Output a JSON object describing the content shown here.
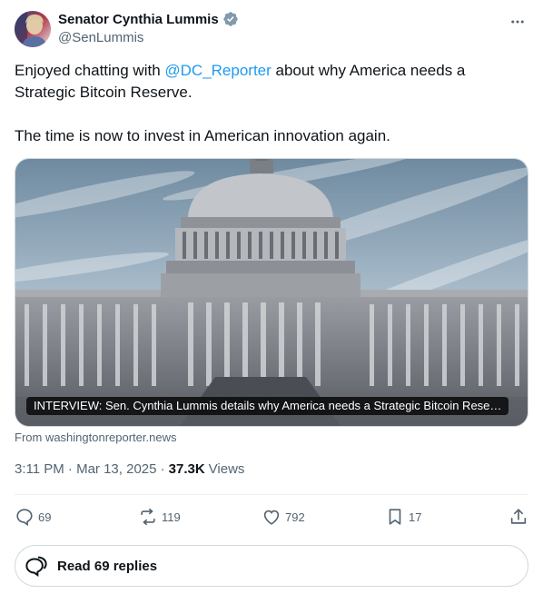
{
  "author": {
    "display_name": "Senator Cynthia Lummis",
    "handle": "@SenLummis"
  },
  "tweet": {
    "text_before_mention": "Enjoyed chatting with ",
    "mention": "@DC_Reporter",
    "text_after_mention": " about why America needs a Strategic Bitcoin Reserve.",
    "text_paragraph_2": "The time is now to invest in American innovation again."
  },
  "card": {
    "title": "INTERVIEW: Sen. Cynthia Lummis details why America needs a Strategic Bitcoin Rese…",
    "source": "From washingtonreporter.news"
  },
  "meta": {
    "timestamp": "3:11 PM · Mar 13, 2025 ·",
    "views_count": "37.3K",
    "views_label": "Views"
  },
  "actions": {
    "replies": "69",
    "reposts": "119",
    "likes": "792",
    "bookmarks": "17"
  },
  "replies_button": {
    "label": "Read 69 replies"
  },
  "colors": {
    "accent": "#1d9bf0",
    "verified_badge": "#829aab",
    "secondary_text": "#536471"
  }
}
